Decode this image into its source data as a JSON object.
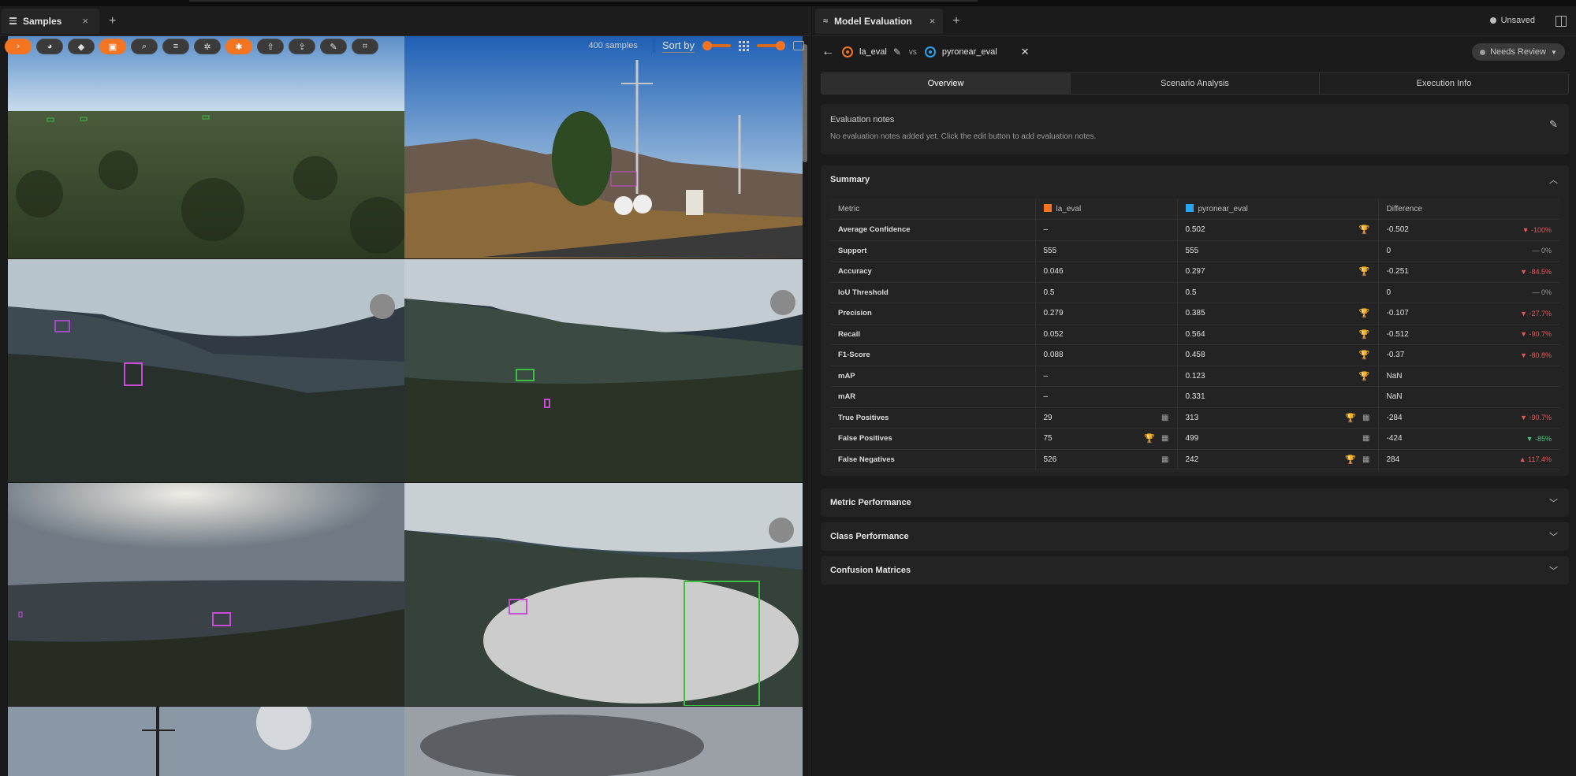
{
  "left": {
    "tab_label": "Samples",
    "tab_close": "×",
    "tab_add": "+",
    "sample_count": "400 samples",
    "sort_by": "Sort by"
  },
  "right": {
    "tab_label": "Model Evaluation",
    "tab_close": "×",
    "tab_add": "+",
    "unsaved": "Unsaved",
    "model_a": "la_eval",
    "vs": "vs",
    "model_b": "pyronear_eval",
    "review_status": "Needs Review",
    "tabs": [
      "Overview",
      "Scenario Analysis",
      "Execution Info"
    ],
    "notes_title": "Evaluation notes",
    "notes_desc": "No evaluation notes added yet. Click the edit button to add evaluation notes.",
    "summary_title": "Summary",
    "columns": {
      "metric": "Metric",
      "a": "la_eval",
      "b": "pyronear_eval",
      "diff": "Difference"
    },
    "colors": {
      "a": "#f47521",
      "b": "#2aa5f2"
    },
    "rows": [
      {
        "metric": "Average Confidence",
        "a": "–",
        "b": "0.502",
        "diff": "-0.502",
        "delta": "▼ -100%",
        "dir": "neg",
        "win": "b",
        "sq": false
      },
      {
        "metric": "Support",
        "a": "555",
        "b": "555",
        "diff": "0",
        "delta": "— 0%",
        "dir": "zero",
        "win": "",
        "sq": false
      },
      {
        "metric": "Accuracy",
        "a": "0.046",
        "b": "0.297",
        "diff": "-0.251",
        "delta": "▼ -84.5%",
        "dir": "neg",
        "win": "b",
        "sq": false
      },
      {
        "metric": "IoU Threshold",
        "a": "0.5",
        "b": "0.5",
        "diff": "0",
        "delta": "— 0%",
        "dir": "zero",
        "win": "",
        "sq": false
      },
      {
        "metric": "Precision",
        "a": "0.279",
        "b": "0.385",
        "diff": "-0.107",
        "delta": "▼ -27.7%",
        "dir": "neg",
        "win": "b",
        "sq": false
      },
      {
        "metric": "Recall",
        "a": "0.052",
        "b": "0.564",
        "diff": "-0.512",
        "delta": "▼ -90.7%",
        "dir": "neg",
        "win": "b",
        "sq": false
      },
      {
        "metric": "F1-Score",
        "a": "0.088",
        "b": "0.458",
        "diff": "-0.37",
        "delta": "▼ -80.8%",
        "dir": "neg",
        "win": "b",
        "sq": false
      },
      {
        "metric": "mAP",
        "a": "–",
        "b": "0.123",
        "diff": "NaN",
        "delta": "",
        "dir": "zero",
        "win": "b",
        "sq": false
      },
      {
        "metric": "mAR",
        "a": "–",
        "b": "0.331",
        "diff": "NaN",
        "delta": "",
        "dir": "zero",
        "win": "",
        "sq": false
      },
      {
        "metric": "True Positives",
        "a": "29",
        "b": "313",
        "diff": "-284",
        "delta": "▼ -90.7%",
        "dir": "neg",
        "win": "b",
        "sq": true
      },
      {
        "metric": "False Positives",
        "a": "75",
        "b": "499",
        "diff": "-424",
        "delta": "▼ -85%",
        "dir": "pos",
        "win": "a",
        "sq": true
      },
      {
        "metric": "False Negatives",
        "a": "526",
        "b": "242",
        "diff": "284",
        "delta": "▲ 117.4%",
        "dir": "neg",
        "win": "b",
        "sq": true
      }
    ],
    "sections": [
      "Metric Performance",
      "Class Performance",
      "Confusion Matrices"
    ]
  }
}
